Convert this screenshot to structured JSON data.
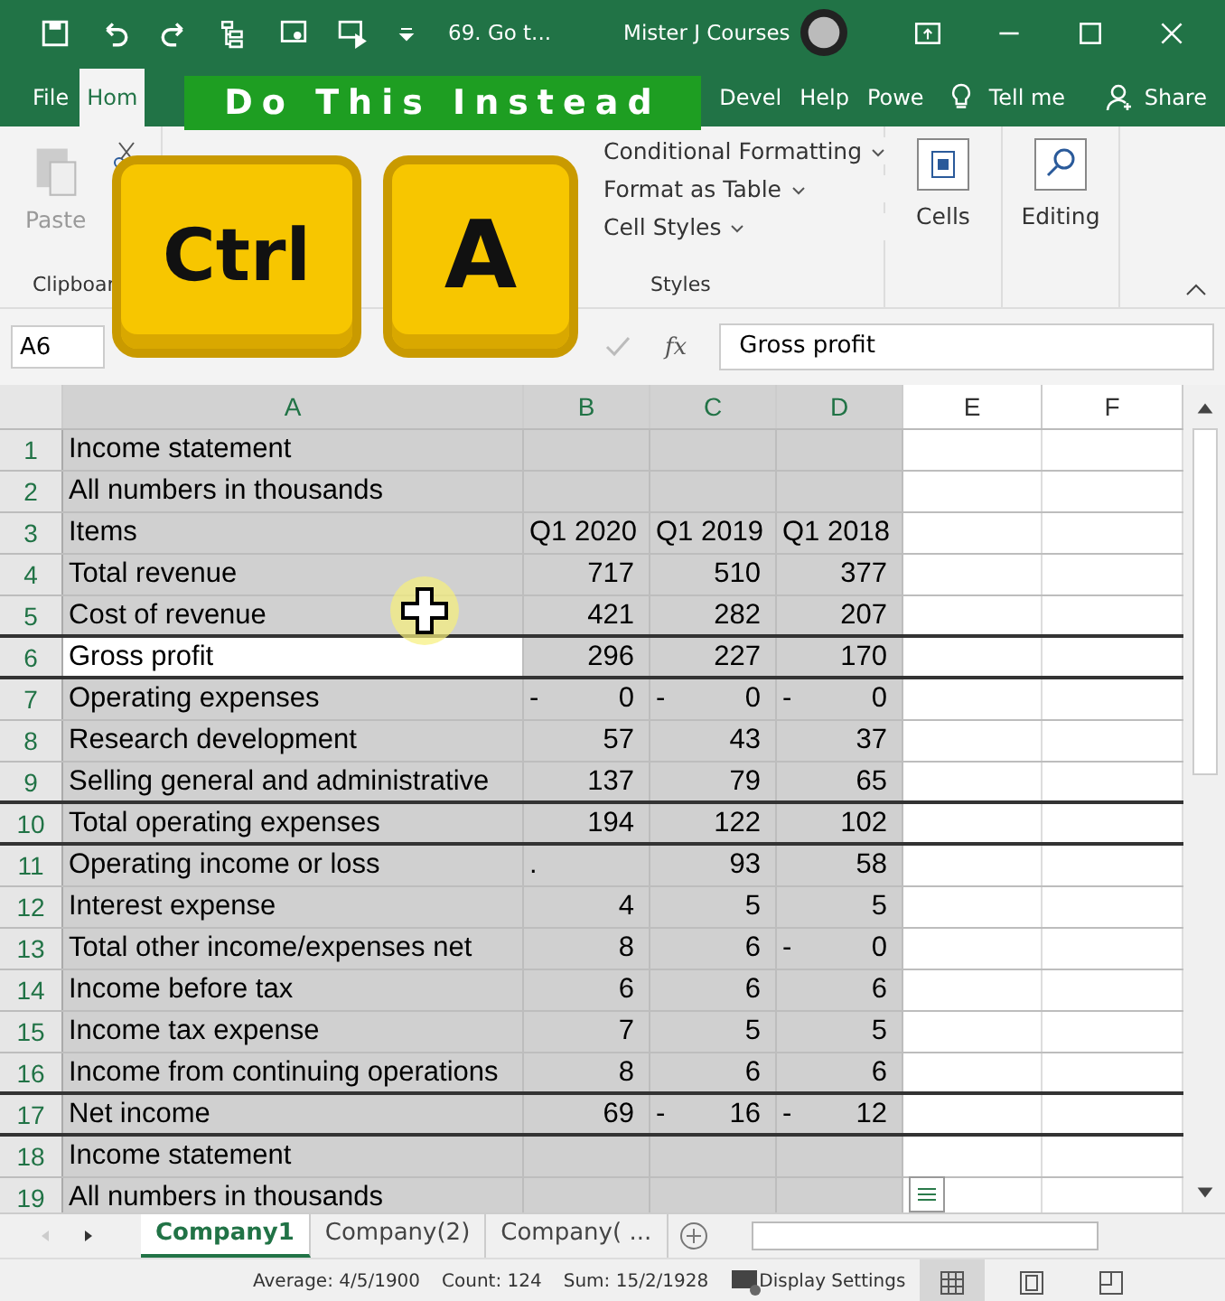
{
  "title_bar": {
    "document": "69. Go t...",
    "account": "Mister J Courses"
  },
  "tabs": [
    {
      "label": "File",
      "selected": false
    },
    {
      "label": "Hom",
      "selected": true
    },
    {
      "label": "Devel",
      "selected": false
    },
    {
      "label": "Help",
      "selected": false
    },
    {
      "label": "Powe",
      "selected": false
    }
  ],
  "tell_me": "Tell me",
  "share": "Share",
  "ribbon": {
    "paste": "Paste",
    "clipboard": "Clipboar",
    "styles_items": [
      "Conditional Formatting",
      "Format as Table",
      "Cell Styles"
    ],
    "styles": "Styles",
    "cells": "Cells",
    "editing": "Editing"
  },
  "overlay": {
    "banner": "Do This Instead",
    "keys": [
      "Ctrl",
      "A"
    ]
  },
  "formula_bar": {
    "name_box": "A6",
    "fx": "fx",
    "value": "Gross profit"
  },
  "columns": [
    {
      "label": "A",
      "selected": true
    },
    {
      "label": "B",
      "selected": true
    },
    {
      "label": "C",
      "selected": true
    },
    {
      "label": "D",
      "selected": true
    },
    {
      "label": "E",
      "selected": false
    },
    {
      "label": "F",
      "selected": false
    }
  ],
  "rows": [
    {
      "num": "1",
      "a": "Income statement",
      "rule_below": false,
      "active": false
    },
    {
      "num": "2",
      "a": "All numbers in thousands",
      "rule_below": false,
      "active": false
    },
    {
      "num": "3",
      "a": "Items",
      "values": [
        {
          "text": "Q1 2020"
        },
        {
          "text": "Q1 2019"
        },
        {
          "text": "Q1 2018"
        }
      ],
      "rule_below": false,
      "active": false
    },
    {
      "num": "4",
      "a": "Total revenue",
      "values": [
        {
          "text": "717"
        },
        {
          "text": "510"
        },
        {
          "text": "377"
        }
      ],
      "rule_below": false,
      "active": false
    },
    {
      "num": "5",
      "a": "Cost of revenue",
      "values": [
        {
          "text": "421"
        },
        {
          "text": "282"
        },
        {
          "text": "207"
        }
      ],
      "rule_below": true,
      "active": false
    },
    {
      "num": "6",
      "a": "Gross profit",
      "values": [
        {
          "text": "296"
        },
        {
          "text": "227"
        },
        {
          "text": "170"
        }
      ],
      "rule_below": true,
      "active": true
    },
    {
      "num": "7",
      "a": "Operating expenses",
      "values": [
        {
          "sign": "-",
          "text": "0"
        },
        {
          "sign": "-",
          "text": "0"
        },
        {
          "sign": "-",
          "text": "0"
        }
      ],
      "rule_below": false,
      "active": false
    },
    {
      "num": "8",
      "a": "Research development",
      "values": [
        {
          "text": "57"
        },
        {
          "text": "43"
        },
        {
          "text": "37"
        }
      ],
      "rule_below": false,
      "active": false
    },
    {
      "num": "9",
      "a": "Selling general and administrative",
      "values": [
        {
          "text": "137"
        },
        {
          "text": "79"
        },
        {
          "text": "65"
        }
      ],
      "rule_below": true,
      "active": false
    },
    {
      "num": "10",
      "a": "Total operating expenses",
      "values": [
        {
          "text": "194"
        },
        {
          "text": "122"
        },
        {
          "text": "102"
        }
      ],
      "rule_below": true,
      "active": false
    },
    {
      "num": "11",
      "a": "Operating income or loss",
      "values": [
        {
          "sign": "."
        },
        {
          "text": "93"
        },
        {
          "text": "58"
        }
      ],
      "rule_below": false,
      "active": false
    },
    {
      "num": "12",
      "a": "Interest expense",
      "values": [
        {
          "text": "4"
        },
        {
          "text": "5"
        },
        {
          "text": "5"
        }
      ],
      "rule_below": false,
      "active": false
    },
    {
      "num": "13",
      "a": "Total other income/expenses net",
      "values": [
        {
          "text": "8"
        },
        {
          "text": "6"
        },
        {
          "sign": "-",
          "text": "0"
        }
      ],
      "rule_below": false,
      "active": false
    },
    {
      "num": "14",
      "a": "Income before tax",
      "values": [
        {
          "text": "6"
        },
        {
          "text": "6"
        },
        {
          "text": "6"
        }
      ],
      "rule_below": false,
      "active": false
    },
    {
      "num": "15",
      "a": "Income tax expense",
      "values": [
        {
          "text": "7"
        },
        {
          "text": "5"
        },
        {
          "text": "5"
        }
      ],
      "rule_below": false,
      "active": false
    },
    {
      "num": "16",
      "a": "Income from continuing operations",
      "values": [
        {
          "text": "8"
        },
        {
          "text": "6"
        },
        {
          "text": "6"
        }
      ],
      "rule_below": true,
      "active": false
    },
    {
      "num": "17",
      "a": "Net income",
      "values": [
        {
          "text": "69"
        },
        {
          "sign": "-",
          "text": "16"
        },
        {
          "sign": "-",
          "text": "12"
        }
      ],
      "rule_below": true,
      "active": false
    },
    {
      "num": "18",
      "a": "Income statement",
      "rule_below": false,
      "active": false
    },
    {
      "num": "19",
      "a": "All numbers in thousands",
      "rule_below": false,
      "active": false
    }
  ],
  "sheets": [
    {
      "label": "Company1",
      "selected": true
    },
    {
      "label": "Company(2)",
      "selected": false
    },
    {
      "label": "Company( ...",
      "selected": false
    }
  ],
  "status_bar": {
    "average": "Average: 4/5/1900",
    "count": "Count: 124",
    "sum": "Sum: 15/2/1928",
    "display": "Display Settings",
    "views": [
      {
        "kind": "normal",
        "selected": true
      },
      {
        "kind": "layout",
        "selected": false
      },
      {
        "kind": "break",
        "selected": false
      }
    ]
  }
}
